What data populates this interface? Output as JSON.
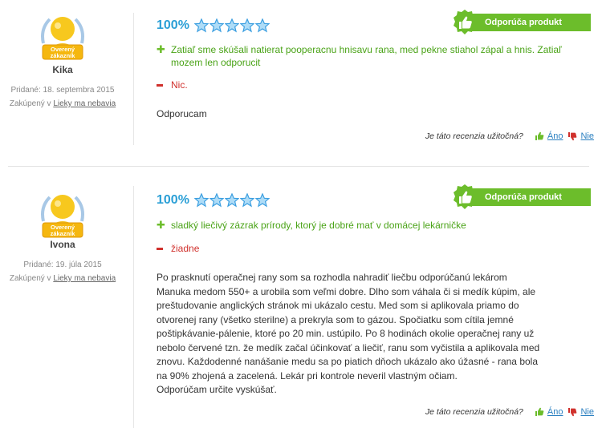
{
  "reviews": [
    {
      "badge_text": "Overený zákazník",
      "author": "Kika",
      "added": "Pridané: 18. septembra 2015",
      "bought_prefix": "Zakúpený v",
      "bought_link": "Lieky ma nebavia",
      "rating_pct": "100%",
      "stars": 5,
      "recommend_label": "Odporúča produkt",
      "pro": "Zatiaľ sme skúšali natierat pooperacnu hnisavu rana, med pekne stiahol zápal a hnis. Zatiaľ mozem len odporucit",
      "con": "Nic.",
      "body": "Odporucam",
      "useful_question": "Je táto recenzia užitočná?",
      "yes_label": "Áno",
      "no_label": "Nie"
    },
    {
      "badge_text": "Overený zákazník",
      "author": "Ivona",
      "added": "Pridané: 19. júla 2015",
      "bought_prefix": "Zakúpený v",
      "bought_link": "Lieky ma nebavia",
      "rating_pct": "100%",
      "stars": 5,
      "recommend_label": "Odporúča produkt",
      "pro": "sladký liečivý zázrak prírody, ktorý je dobré mať v domácej lekárničke",
      "con": "žiadne",
      "body": "Po prasknutí operačnej rany som sa rozhodla nahradiť liečbu odporúčanú lekárom Manuka medom 550+ a urobila som veľmi dobre. Dlho som váhala či si medík kúpim, ale preštudovanie anglických stránok mi ukázalo cestu. Med som si aplikovala priamo do otvorenej rany (všetko sterilne) a prekryla som to gázou. Spočiatku som cítila jemné poštipkávanie-pálenie, ktoré po 20 min. ustúpilo. Po 8 hodinách okolie operačnej rany už nebolo červené tzn. že medík začal účinkovať a liečiť, ranu som vyčistila a aplikovala med znovu. Každodenné nanášanie medu sa po piatich dňoch ukázalo ako úžasné - rana bola na 90% zhojená a zacelená. Lekár pri kontrole neveril vlastným očiam.",
      "body_end": "Odporúčam určite vyskúšať.",
      "useful_question": "Je táto recenzia užitočná?",
      "yes_label": "Áno",
      "no_label": "Nie"
    }
  ],
  "colors": {
    "rating": "#2a9fd6",
    "recommend_green": "#6cbd2b",
    "pro_text": "#4aa317",
    "con_text": "#d0312d",
    "link": "#2a7fc0",
    "star": "#3a9ee0"
  },
  "icons": [
    "verified-customer-badge-icon",
    "star-icon",
    "thumbs-up-icon",
    "plus-icon",
    "minus-icon",
    "thumbs-down-icon"
  ]
}
